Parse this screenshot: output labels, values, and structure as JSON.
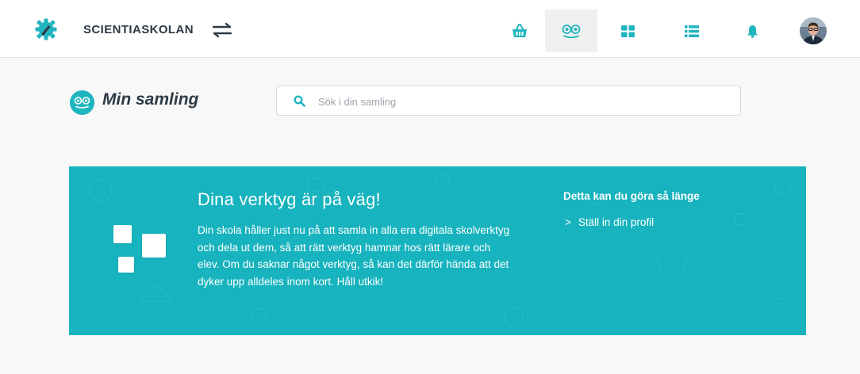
{
  "header": {
    "brand": "SCIENTIASKOLAN",
    "nav": [
      {
        "icon": "basket-icon"
      },
      {
        "icon": "collection-icon",
        "active": true
      },
      {
        "icon": "grid-icon"
      },
      {
        "icon": "list-icon"
      },
      {
        "icon": "bell-icon"
      }
    ]
  },
  "page": {
    "title": "Min samling"
  },
  "search": {
    "placeholder": "Sök i din samling",
    "value": ""
  },
  "banner": {
    "title": "Dina verktyg är på väg!",
    "text": "Din skola håller just nu på att samla in alla era digitala skolverktyg och dela ut dem, så att rätt verktyg hamnar hos rätt lärare och elev. Om du saknar något verktyg, så kan det därför hända att det dyker upp alldeles inom kort. Håll utkik!",
    "side_title": "Detta kan du göra så länge",
    "links": [
      {
        "chevron": ">",
        "label": "Ställ in din profil"
      }
    ]
  },
  "colors": {
    "accent": "#17b3be",
    "icon": "#1fb5bf",
    "background": "#f8f8f8"
  }
}
